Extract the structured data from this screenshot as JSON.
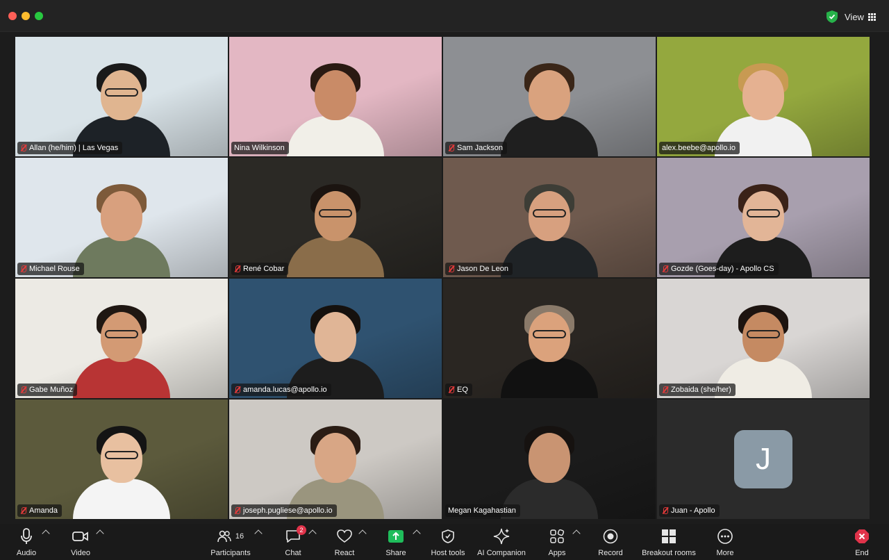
{
  "window": {
    "view_label": "View"
  },
  "participants": [
    {
      "name": "Allan (he/him) | Las Vegas",
      "muted": true,
      "bg": "#d9e3e8",
      "skin": "#e0b590",
      "hair": "#1a1a1a",
      "shirt": "#1d2227",
      "glasses": true
    },
    {
      "name": "Nina Wilkinson",
      "muted": false,
      "bg": "#e3b7c3",
      "skin": "#c98b67",
      "hair": "#2a1a12",
      "shirt": "#f1efe8",
      "glasses": false,
      "active": true
    },
    {
      "name": "Sam Jackson",
      "muted": true,
      "bg": "#8d8f93",
      "skin": "#d9a27e",
      "hair": "#3a2618",
      "shirt": "#1f1f1f",
      "glasses": false
    },
    {
      "name": "alex.beebe@apollo.io",
      "muted": false,
      "bg": "#94a83e",
      "skin": "#e5b191",
      "hair": "#c89a52",
      "shirt": "#f1f1f1",
      "glasses": false
    },
    {
      "name": "Michael Rouse",
      "muted": true,
      "bg": "#dfe6ec",
      "skin": "#d8a07e",
      "hair": "#7d5a3a",
      "shirt": "#6e7a5e",
      "glasses": false
    },
    {
      "name": "René Cobar",
      "muted": true,
      "bg": "#2b2925",
      "skin": "#c9936b",
      "hair": "#1b1410",
      "shirt": "#8a6d4a",
      "glasses": true
    },
    {
      "name": "Jason De Leon",
      "muted": true,
      "bg": "#6f5a4e",
      "skin": "#d7a07f",
      "hair": "#3d3d36",
      "shirt": "#1f2326",
      "glasses": true
    },
    {
      "name": "Gozde (Goes-day) - Apollo CS",
      "muted": true,
      "bg": "#a89fae",
      "skin": "#e2b597",
      "hair": "#3a2218",
      "shirt": "#1d1d1d",
      "glasses": true
    },
    {
      "name": "Gabe Muñoz",
      "muted": true,
      "bg": "#eceae4",
      "skin": "#d39a74",
      "hair": "#1f1712",
      "shirt": "#b83434",
      "glasses": true
    },
    {
      "name": "amanda.lucas@apollo.io",
      "muted": true,
      "bg": "#2f5270",
      "skin": "#e0b596",
      "hair": "#15110e",
      "shirt": "#1d1d1d",
      "glasses": false
    },
    {
      "name": "EQ",
      "muted": true,
      "bg": "#2a2622",
      "skin": "#dba27c",
      "hair": "#8a7a6a",
      "shirt": "#111111",
      "glasses": true
    },
    {
      "name": "Zobaida (she/her)",
      "muted": true,
      "bg": "#d9d6d4",
      "skin": "#c58a62",
      "hair": "#1d1410",
      "shirt": "#efece4",
      "glasses": true
    },
    {
      "name": "Amanda",
      "muted": true,
      "bg": "#5c5a3c",
      "skin": "#e8c0a0",
      "hair": "#141414",
      "shirt": "#f4f4f4",
      "glasses": true
    },
    {
      "name": "joseph.pugliese@apollo.io",
      "muted": true,
      "bg": "#cdc9c4",
      "skin": "#d8a685",
      "hair": "#2a1c14",
      "shirt": "#9a957e",
      "glasses": false
    },
    {
      "name": "Megan Kagahastian",
      "muted": false,
      "bg": "#1b1b1b",
      "skin": "#c99472",
      "hair": "#161210",
      "shirt": "#2b2b2b",
      "glasses": false
    },
    {
      "name": "Juan - Apollo",
      "muted": true,
      "avatar_letter": "J",
      "bg": "#2b2b2b"
    }
  ],
  "toolbar": {
    "audio": "Audio",
    "video": "Video",
    "participants": "Participants",
    "participants_count": "16",
    "chat": "Chat",
    "chat_badge": "2",
    "react": "React",
    "share": "Share",
    "host_tools": "Host tools",
    "ai_companion": "AI Companion",
    "apps": "Apps",
    "record": "Record",
    "breakout_rooms": "Breakout rooms",
    "more": "More",
    "end": "End"
  },
  "colors": {
    "accent_green": "#3ec95a",
    "end_red": "#e0334a",
    "share_green": "#1fbd5b"
  }
}
